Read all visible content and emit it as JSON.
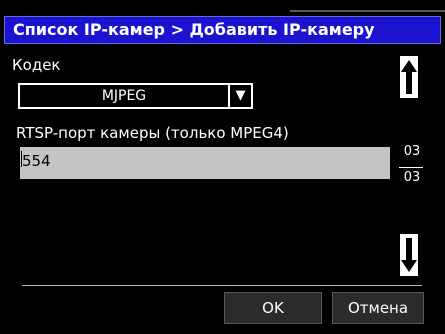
{
  "title": "Список IP-камер > Добавить IP-камеру",
  "codec": {
    "label": "Кодек",
    "value": "MJPEG"
  },
  "rtsp": {
    "label": "RTSP-порт камеры (только MPEG4)",
    "value": "554"
  },
  "pager": {
    "current": "03",
    "total": "03"
  },
  "buttons": {
    "ok": "OK",
    "cancel": "Отмена"
  },
  "colors": {
    "titlebar": "#1b13cf",
    "background": "#000000",
    "input": "#c4c4c4"
  }
}
